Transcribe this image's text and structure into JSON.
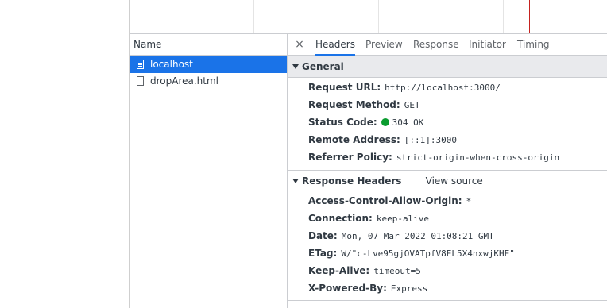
{
  "network": {
    "name_header": "Name",
    "requests": [
      {
        "name": "localhost",
        "selected": true
      },
      {
        "name": "dropArea.html",
        "selected": false
      }
    ]
  },
  "details": {
    "tabs": [
      "Headers",
      "Preview",
      "Response",
      "Initiator",
      "Timing"
    ],
    "active_tab": "Headers",
    "close_icon": "×",
    "general": {
      "title": "General",
      "rows": [
        {
          "key": "Request URL:",
          "value": "http://localhost:3000/"
        },
        {
          "key": "Request Method:",
          "value": "GET"
        },
        {
          "key": "Status Code:",
          "value": "304 OK",
          "status_color": "#0a9c2f"
        },
        {
          "key": "Remote Address:",
          "value": "[::1]:3000"
        },
        {
          "key": "Referrer Policy:",
          "value": "strict-origin-when-cross-origin"
        }
      ]
    },
    "response_headers": {
      "title": "Response Headers",
      "view_source": "View source",
      "rows": [
        {
          "key": "Access-Control-Allow-Origin:",
          "value": "*"
        },
        {
          "key": "Connection:",
          "value": "keep-alive"
        },
        {
          "key": "Date:",
          "value": "Mon, 07 Mar 2022 01:08:21 GMT"
        },
        {
          "key": "ETag:",
          "value": "W/\"c-Lve95gjOVATpfV8EL5X4nxwjKHE\""
        },
        {
          "key": "Keep-Alive:",
          "value": "timeout=5"
        },
        {
          "key": "X-Powered-By:",
          "value": "Express"
        }
      ]
    }
  },
  "colors": {
    "selection": "#1a73e8",
    "dom_content_loaded_line": "#1a73e8",
    "load_line": "#c5221f",
    "status_ok": "#0a9c2f"
  }
}
